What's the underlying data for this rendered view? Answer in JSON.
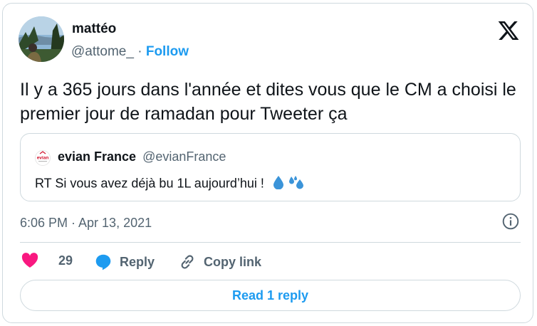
{
  "tweet": {
    "author_name": "mattéo",
    "author_handle": "@attome_",
    "separator": "·",
    "follow_label": "Follow",
    "text": "Il y a 365 jours dans l'année et dites vous que le CM a choisi le premier jour de ramadan pour Tweeter ça",
    "timestamp": "6:06 PM · Apr 13, 2021"
  },
  "quote": {
    "author_name": "evian France",
    "author_handle": "@evianFrance",
    "text": "RT Si vous avez déjà bu 1L aujourd’hui !",
    "logo_text": "evian",
    "emoji_icons": [
      "droplet-icon",
      "sweat-droplets-icon"
    ]
  },
  "actions": {
    "like_count": "29",
    "reply_label": "Reply",
    "copy_link_label": "Copy link",
    "read_replies_label": "Read 1 reply"
  },
  "colors": {
    "accent": "#1d9bf0",
    "like": "#f91880",
    "text": "#0f1419",
    "muted": "#536471",
    "border": "#cfd9de"
  }
}
